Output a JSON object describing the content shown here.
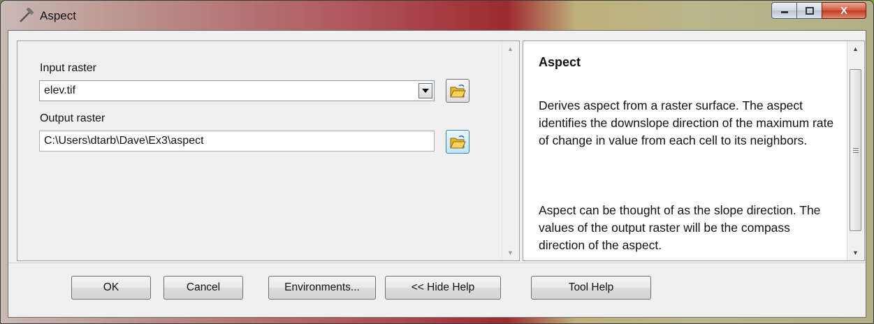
{
  "window": {
    "title": "Aspect",
    "icon": "hammer-icon",
    "controls": {
      "minimize": "minimize-icon",
      "maximize": "maximize-icon",
      "close": "X"
    }
  },
  "form": {
    "input_raster": {
      "label": "Input raster",
      "value": "elev.tif"
    },
    "output_raster": {
      "label": "Output raster",
      "value": "C:\\Users\\dtarb\\Dave\\Ex3\\aspect"
    }
  },
  "help": {
    "title": "Aspect",
    "paragraphs": [
      "Derives aspect from a raster surface. The aspect identifies the downslope direction of the maximum rate of change in value from each cell to its neighbors.",
      "Aspect can be thought of as the slope direction. The values of the output raster will be the compass direction of the aspect."
    ]
  },
  "buttons": {
    "ok": "OK",
    "cancel": "Cancel",
    "environments": "Environments...",
    "hide_help": "<< Hide Help",
    "tool_help": "Tool Help"
  }
}
